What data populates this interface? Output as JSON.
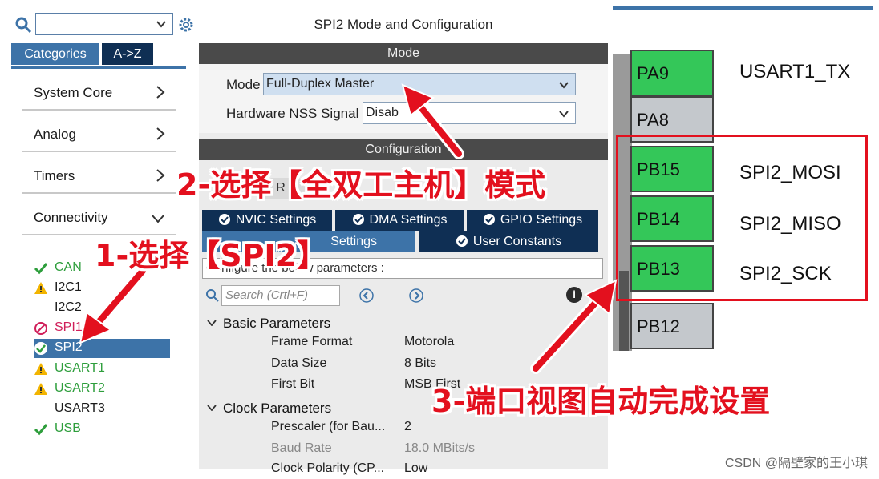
{
  "left_panel": {
    "search_value": "",
    "tabs": [
      {
        "label": "Categories"
      },
      {
        "label": "A->Z"
      }
    ],
    "categories": [
      {
        "label": "System Core",
        "expanded": false
      },
      {
        "label": "Analog",
        "expanded": false
      },
      {
        "label": "Timers",
        "expanded": false
      },
      {
        "label": "Connectivity",
        "expanded": true
      }
    ],
    "peripherals": [
      {
        "label": "CAN",
        "status": "ok",
        "color": "#2e9e3c"
      },
      {
        "label": "I2C1",
        "status": "warning",
        "color": "#1a1a1a"
      },
      {
        "label": "I2C2",
        "status": "none",
        "color": "#1a1a1a"
      },
      {
        "label": "SPI1",
        "status": "disabled",
        "color": "#d01f5a"
      },
      {
        "label": "SPI2",
        "status": "selected",
        "color": "#ffffff"
      },
      {
        "label": "USART1",
        "status": "warning",
        "color": "#2e9e3c"
      },
      {
        "label": "USART2",
        "status": "warning",
        "color": "#2e9e3c"
      },
      {
        "label": "USART3",
        "status": "none",
        "color": "#1a1a1a"
      },
      {
        "label": "USB",
        "status": "ok",
        "color": "#2e9e3c"
      }
    ]
  },
  "mid_panel": {
    "title": "SPI2 Mode and Configuration",
    "mode_header": "Mode",
    "mode_label": "Mode",
    "mode_value": "Full-Duplex Master",
    "nss_label": "Hardware NSS Signal",
    "nss_value": "Disab",
    "config_header": "Configuration",
    "reset_tab_partial": "R",
    "tabs_row1": [
      {
        "label": "NVIC Settings"
      },
      {
        "label": "DMA Settings"
      },
      {
        "label": "GPIO Settings"
      }
    ],
    "tabs_row2": [
      {
        "label": "Settings"
      },
      {
        "label": "User Constants"
      }
    ],
    "param_desc": "Configure the below parameters :",
    "search_placeholder": "Search (Crtl+F)",
    "info_glyph": "i",
    "groups": [
      {
        "label": "Basic Parameters",
        "params": [
          {
            "name": "Frame Format",
            "value": "Motorola"
          },
          {
            "name": "Data Size",
            "value": "8 Bits"
          },
          {
            "name": "First Bit",
            "value": "MSB First"
          }
        ]
      },
      {
        "label": "Clock Parameters",
        "params": [
          {
            "name": "Prescaler (for Bau...",
            "value": "2"
          },
          {
            "name": "Baud Rate",
            "value": "18.0 MBits/s"
          },
          {
            "name": "Clock Polarity (CP...",
            "value": "Low"
          }
        ]
      }
    ]
  },
  "pinout": {
    "pins": [
      {
        "pin": "PA9",
        "signal": "USART1_TX",
        "color": "#34c759"
      },
      {
        "pin": "PA8",
        "signal": "",
        "color": "#c4c8cc"
      },
      {
        "pin": "PB15",
        "signal": "SPI2_MOSI",
        "color": "#34c759"
      },
      {
        "pin": "PB14",
        "signal": "SPI2_MISO",
        "color": "#34c759"
      },
      {
        "pin": "PB13",
        "signal": "SPI2_SCK",
        "color": "#34c759"
      },
      {
        "pin": "PB12",
        "signal": "",
        "color": "#c4c8cc"
      }
    ]
  },
  "annotations": {
    "step1": "1-选择【SPI2】",
    "step2": "2-选择【全双工主机】模式",
    "step3": "3-端口视图自动完成设置",
    "color": "#e3101e"
  },
  "watermark": "CSDN @隔壁家的王小琪",
  "colors": {
    "tab_active": "#3d73a8",
    "tab_dark": "#0f2f54",
    "pin_green": "#34c759",
    "highlight_red": "#e3101e"
  }
}
